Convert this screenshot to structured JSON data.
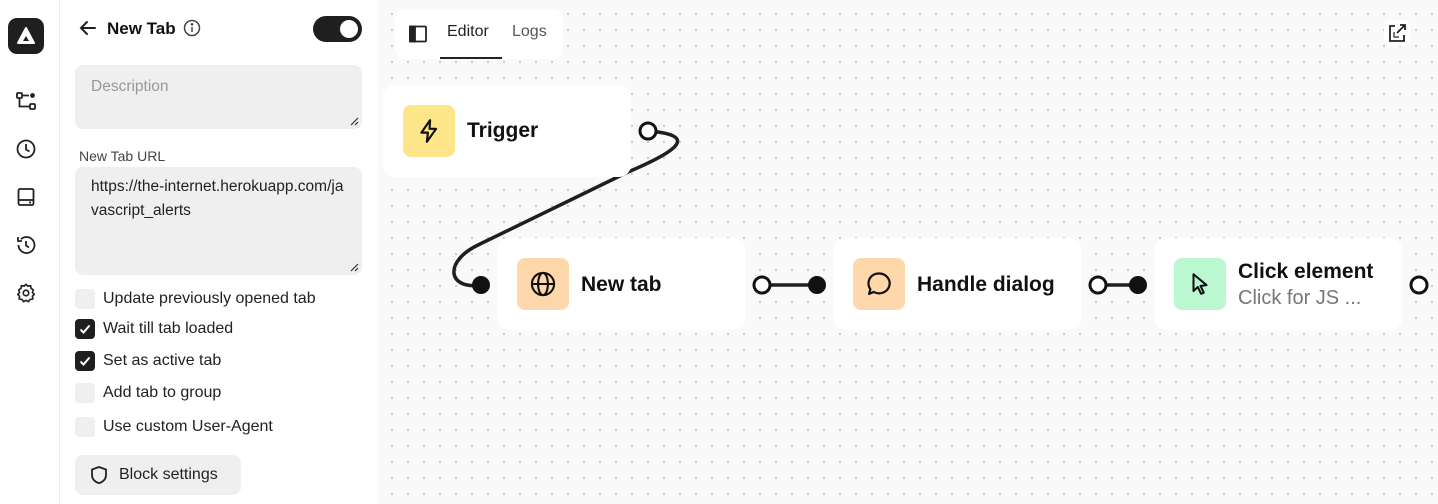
{
  "rail": {
    "logo": "automa-logo-icon",
    "items": [
      {
        "icon": "workflow-icon"
      },
      {
        "icon": "clock-icon"
      },
      {
        "icon": "storage-icon"
      },
      {
        "icon": "history-icon"
      },
      {
        "icon": "gear-icon"
      }
    ]
  },
  "panel": {
    "title": "New Tab",
    "description_placeholder": "Description",
    "url_label": "New Tab URL",
    "url_value": "https://the-internet.herokuapp.com/javascript_alerts",
    "toggle_on": true,
    "options": [
      {
        "label": "Update previously opened tab",
        "checked": false
      },
      {
        "label": "Wait till tab loaded",
        "checked": true
      },
      {
        "label": "Set as active tab",
        "checked": true
      },
      {
        "label": "Add tab to group",
        "checked": false
      },
      {
        "label": "Use custom User-Agent",
        "checked": false
      }
    ],
    "block_settings_label": "Block settings"
  },
  "canvas": {
    "tabs": [
      {
        "label": "Editor",
        "active": true
      },
      {
        "label": "Logs",
        "active": false
      }
    ],
    "nodes": [
      {
        "title": "Trigger",
        "icon": "lightning-icon",
        "color": "#fde68a"
      },
      {
        "title": "New tab",
        "icon": "globe-icon",
        "color": "#fed7aa"
      },
      {
        "title": "Handle dialog",
        "icon": "chat-bubble-icon",
        "color": "#fed7aa"
      },
      {
        "title": "Click element",
        "subtitle": "Click for JS ...",
        "icon": "cursor-icon",
        "color": "#bbf7d0"
      }
    ]
  }
}
